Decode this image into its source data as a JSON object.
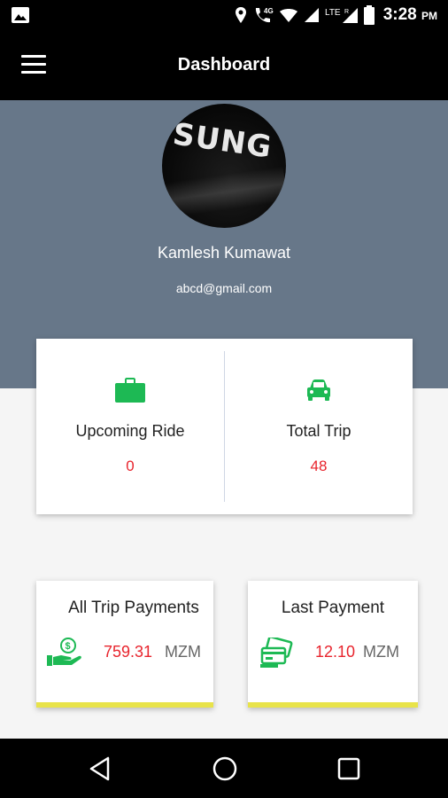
{
  "status_bar": {
    "time": "3:28",
    "ampm": "PM",
    "network_label": "4G",
    "lte_label": "LTE",
    "roaming_label": "R"
  },
  "app_bar": {
    "title": "Dashboard"
  },
  "profile": {
    "avatar_text": "SUNG",
    "name": "Kamlesh Kumawat",
    "email": "abcd@gmail.com"
  },
  "stats": {
    "upcoming_ride": {
      "label": "Upcoming Ride",
      "value": "0",
      "icon": "briefcase-icon"
    },
    "total_trip": {
      "label": "Total Trip",
      "value": "48",
      "icon": "car-icon"
    }
  },
  "payments": {
    "all_trip": {
      "title": "All Trip Payments",
      "amount": "759.31",
      "currency": "MZM",
      "icon": "hand-money-icon"
    },
    "last": {
      "title": "Last Payment",
      "amount": "12.10",
      "currency": "MZM",
      "icon": "card-payment-icon"
    }
  },
  "colors": {
    "header_bg": "#677789",
    "accent_green": "#1db954",
    "value_red": "#e8242d",
    "card_underline": "#e8e34a"
  }
}
